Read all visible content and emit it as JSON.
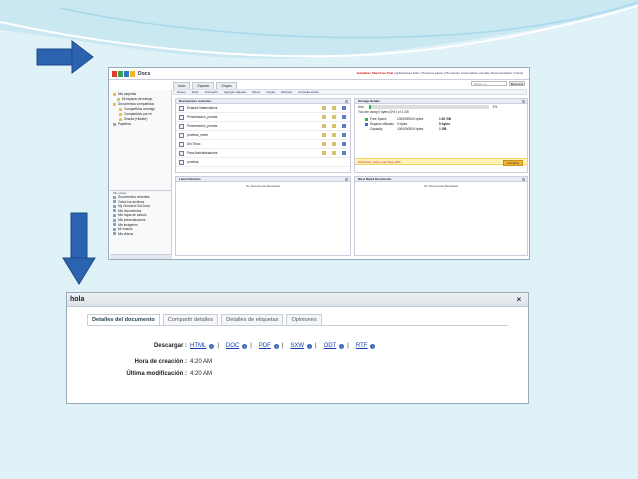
{
  "app": {
    "logo_text": "Docs",
    "top_links": [
      "Actualiza",
      "Start Free Trial",
      "Aplicaciones Zoho",
      "Primeros pasos",
      "Mi cuenta",
      "Comentarios",
      "Ayuda",
      "Documentación",
      "Cerrar"
    ],
    "tabs": [
      "Inicio",
      "Explorar",
      "Grupos"
    ],
    "search_placeholder": "Buscar en",
    "search_button": "Búsqueda",
    "toolbar": [
      "Nuevo",
      "Subir",
      "Compartir",
      "Agregar etiqueta",
      "Mover",
      "Copiar",
      "Eliminar",
      "Consulta activa"
    ]
  },
  "sidebar": {
    "tree": [
      "Mis carpetas",
      "Mi espacio de trabajo",
      "Documentos compartidos",
      "Compartidos conmigo",
      "Compartidos por mí",
      "Shared (Hidden)",
      "Papelera"
    ],
    "views_title": "Mis vistas",
    "views": [
      "Documentos recientes",
      "Todos los archivos",
      "My Checked Out Docs",
      "Mis documentos",
      "Mis hojas de cálculo",
      "Mis presentaciones",
      "Mis imágenes",
      "Mi música",
      "Mis videos"
    ]
  },
  "recent_docs": {
    "title": "Documentos recientes",
    "items": [
      "Enlaces Matemáticos",
      "Presentación_prueba",
      "Presentación_prueba",
      "pruebas_sheet",
      "Sin Título",
      "Para Administradores",
      "pruebas"
    ]
  },
  "storage": {
    "title": "Storage Details",
    "use_label": "Use:",
    "use_percent": 0.02,
    "use_text": "You are using 0 bytes (0% ) of 1 GB",
    "rows": [
      {
        "label": "Free Space",
        "bytes": "1000000000 bytes",
        "size": "1.00 GB",
        "color": "#2fb34a"
      },
      {
        "label": "Espacio utilizado",
        "bytes": "0 bytes",
        "size": "0 bytes",
        "color": "#3b6fc2"
      },
      {
        "label": "Capacity",
        "bytes": "1000000000 bytes",
        "size": "1 GB",
        "color": ""
      }
    ],
    "promo": "Subscribe Yearly and Save 20%",
    "promo_button": "Actualiza"
  },
  "latest_reviews": {
    "title": "Latest Reviews",
    "empty": "No Documents Reviewed"
  },
  "most_rated": {
    "title": "Most Rated Documents",
    "empty": "No Documents Reviewed"
  },
  "dialog": {
    "title": "hola",
    "close": "×",
    "tabs": [
      "Detalles del documento",
      "Compartir detalles",
      "Detalles de etiquetas",
      "Opiniones"
    ],
    "download_label": "Descargar :",
    "formats": [
      "HTML",
      "DOC",
      "PDF",
      "SXW",
      "ODT",
      "RTF"
    ],
    "created_label": "Hora de creación :",
    "created_value": "4:20 AM",
    "modified_label": "Última modificación :",
    "modified_value": "4:20 AM"
  },
  "colors": {
    "background": "#dff2f8",
    "arrow": "#2c63b0",
    "accent_link": "#1540b0"
  }
}
